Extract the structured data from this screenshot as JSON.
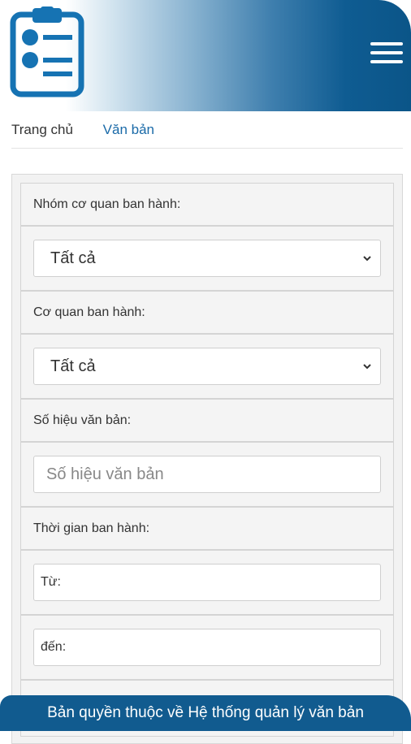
{
  "header": {
    "logo_icon": "clipboard-icon",
    "menu_icon": "hamburger-menu-icon",
    "gradient_colors": [
      "#ffffff",
      "#8fb7d3",
      "#0b5588"
    ]
  },
  "breadcrumb": {
    "home": "Trang chủ",
    "current": "Văn bản"
  },
  "filters": {
    "issuing_group": {
      "label": "Nhóm cơ quan ban hành:",
      "value": "Tất cả"
    },
    "issuing_agency": {
      "label": "Cơ quan ban hành:",
      "value": "Tất cả"
    },
    "doc_number": {
      "label": "Số hiệu văn bản:",
      "placeholder": "Số hiệu văn bản",
      "value": ""
    },
    "issue_date": {
      "label": "Thời gian ban hành:",
      "from_label": "Từ:",
      "to_label": "đến:"
    }
  },
  "footer": {
    "text": "Bản quyền thuộc về Hệ thống quản lý văn bản",
    "color": "#115b8f"
  },
  "accent_color": "#1a6aa8"
}
